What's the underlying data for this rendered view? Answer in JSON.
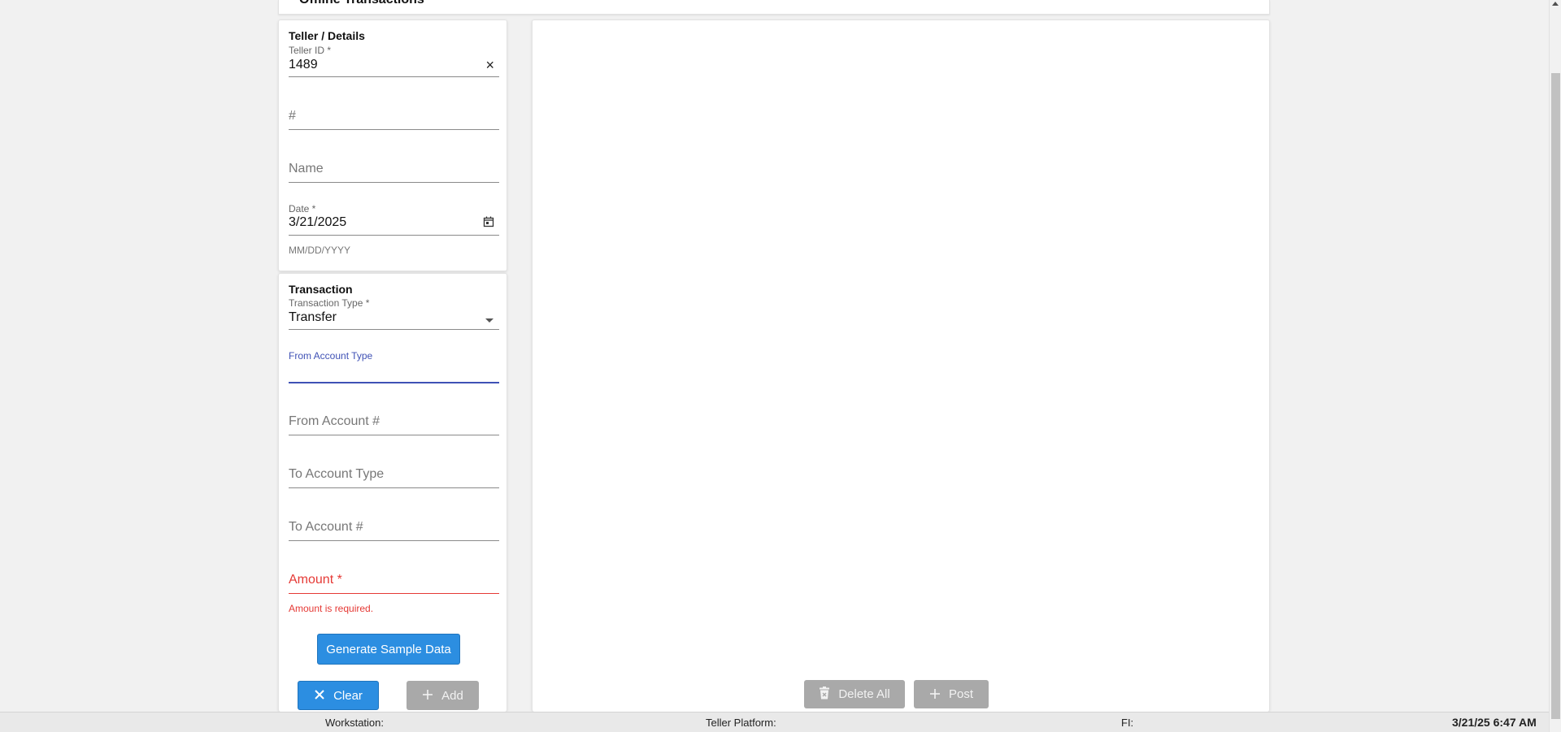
{
  "header": {
    "title": "Offline Transactions"
  },
  "teller": {
    "section_title": "Teller / Details",
    "teller_id_label": "Teller ID *",
    "teller_id_value": "1489",
    "number_placeholder": "#",
    "name_placeholder": "Name",
    "date_label": "Date *",
    "date_value": "3/21/2025",
    "date_helper": "MM/DD/YYYY"
  },
  "transaction": {
    "section_title": "Transaction",
    "type_label": "Transaction Type *",
    "type_value": "Transfer",
    "from_type_label": "From Account Type",
    "from_account_placeholder": "From Account #",
    "to_type_placeholder": "To Account Type",
    "to_account_placeholder": "To Account #",
    "amount_placeholder": "Amount *",
    "amount_error": "Amount is required.",
    "generate_label": "Generate Sample Data",
    "clear_label": "Clear",
    "add_label": "Add"
  },
  "main": {
    "delete_all_label": "Delete All",
    "post_label": "Post"
  },
  "status": {
    "workstation": "Workstation:",
    "platform": "Teller Platform:",
    "fi": "FI:",
    "clock": "3/21/25 6:47 AM"
  },
  "colors": {
    "primary": "#2c8ee1",
    "focus": "#3f51b5",
    "error": "#e53935",
    "disabled": "#a9a9a9"
  },
  "icons": {
    "clear_field": "close-icon",
    "date_picker": "calendar-icon",
    "dropdown": "caret-down-icon",
    "clear_button": "x-icon",
    "add_button": "plus-icon",
    "delete_all_button": "trash-icon",
    "post_button": "plus-icon"
  }
}
